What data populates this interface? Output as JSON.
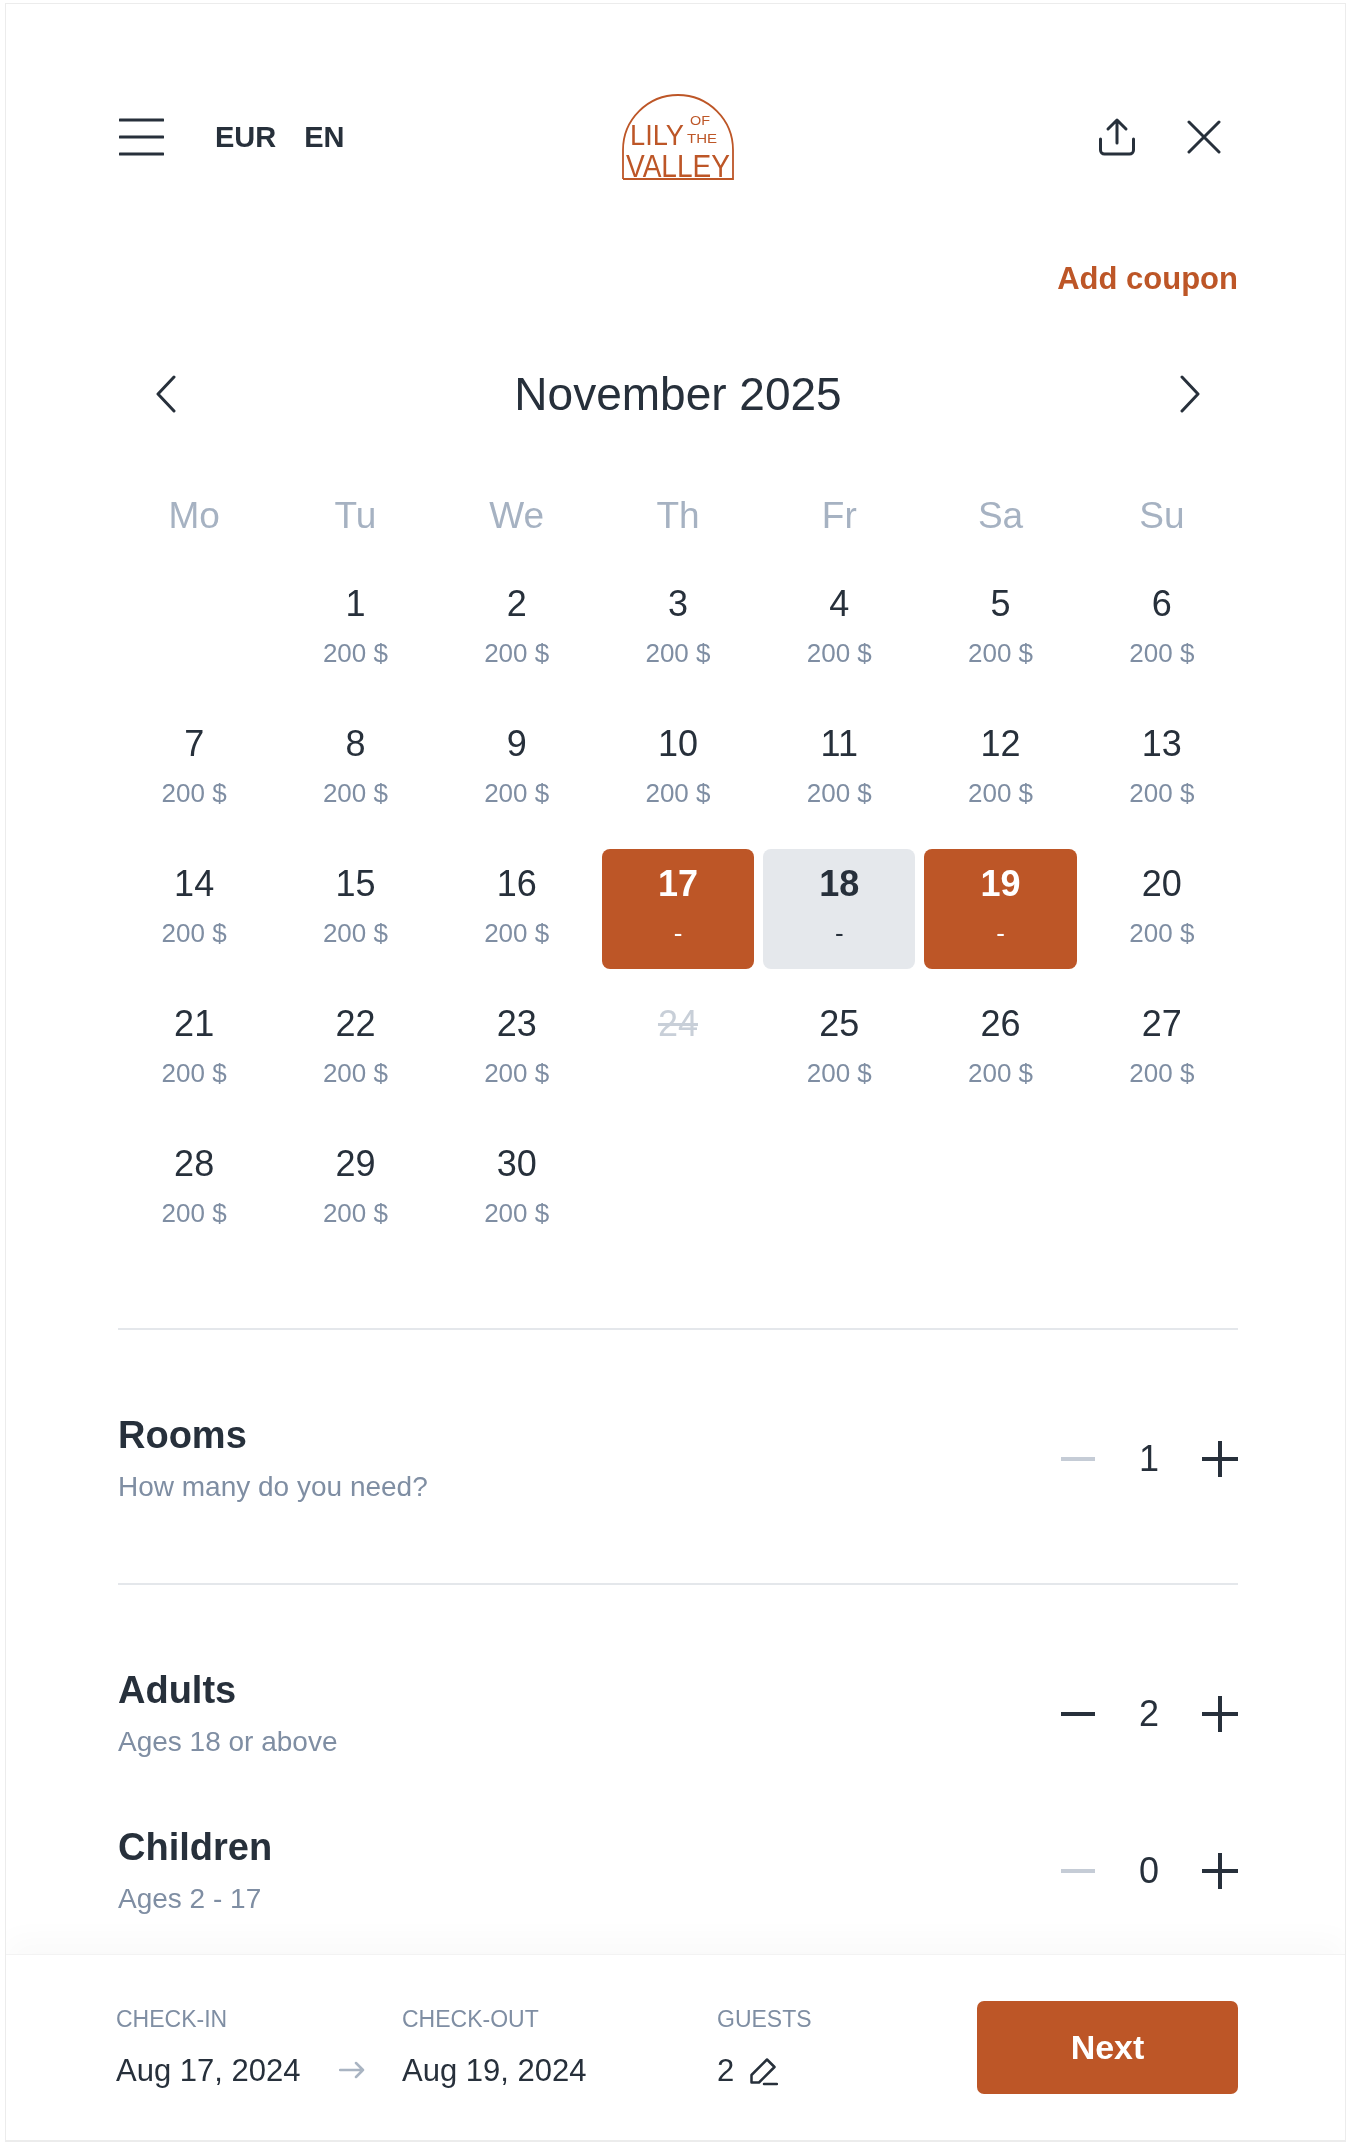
{
  "header": {
    "currency": "EUR",
    "language": "EN",
    "logo": {
      "lines": [
        "LILY",
        "OF",
        "THE",
        "VALLEY"
      ]
    }
  },
  "coupon_link": "Add coupon",
  "calendar": {
    "month": "November 2025",
    "weekdays": [
      "Mo",
      "Tu",
      "We",
      "Th",
      "Fr",
      "Sa",
      "Su"
    ],
    "weeks": [
      {
        "days": [
          {
            "day": "1",
            "price": "200 $",
            "selected": false,
            "in_range": false,
            "disabled": false
          },
          {
            "day": "2",
            "price": "200 $",
            "selected": false,
            "in_range": false,
            "disabled": false
          },
          {
            "day": "3",
            "price": "200 $",
            "selected": false,
            "in_range": false,
            "disabled": false
          },
          {
            "day": "4",
            "price": "200 $",
            "selected": false,
            "in_range": false,
            "disabled": false
          },
          {
            "day": "5",
            "price": "200 $",
            "selected": false,
            "in_range": false,
            "disabled": false
          },
          {
            "day": "6",
            "price": "200 $",
            "selected": false,
            "in_range": false,
            "disabled": false
          }
        ]
      },
      {
        "days": [
          {
            "day": "7",
            "price": "200 $",
            "selected": false,
            "in_range": false,
            "disabled": false
          },
          {
            "day": "8",
            "price": "200 $",
            "selected": false,
            "in_range": false,
            "disabled": false
          },
          {
            "day": "9",
            "price": "200 $",
            "selected": false,
            "in_range": false,
            "disabled": false
          },
          {
            "day": "10",
            "price": "200 $",
            "selected": false,
            "in_range": false,
            "disabled": false
          },
          {
            "day": "11",
            "price": "200 $",
            "selected": false,
            "in_range": false,
            "disabled": false
          },
          {
            "day": "12",
            "price": "200 $",
            "selected": false,
            "in_range": false,
            "disabled": false
          },
          {
            "day": "13",
            "price": "200 $",
            "selected": false,
            "in_range": false,
            "disabled": false
          }
        ]
      },
      {
        "days": [
          {
            "day": "14",
            "price": "200 $",
            "selected": false,
            "in_range": false,
            "disabled": false
          },
          {
            "day": "15",
            "price": "200 $",
            "selected": false,
            "in_range": false,
            "disabled": false
          },
          {
            "day": "16",
            "price": "200 $",
            "selected": false,
            "in_range": false,
            "disabled": false
          },
          {
            "day": "17",
            "price": "-",
            "selected": true,
            "in_range": false,
            "disabled": false
          },
          {
            "day": "18",
            "price": "-",
            "selected": false,
            "in_range": true,
            "disabled": false
          },
          {
            "day": "19",
            "price": "-",
            "selected": true,
            "in_range": false,
            "disabled": false
          },
          {
            "day": "20",
            "price": "200 $",
            "selected": false,
            "in_range": false,
            "disabled": false
          }
        ]
      },
      {
        "days": [
          {
            "day": "21",
            "price": "200 $",
            "selected": false,
            "in_range": false,
            "disabled": false
          },
          {
            "day": "22",
            "price": "200 $",
            "selected": false,
            "in_range": false,
            "disabled": false
          },
          {
            "day": "23",
            "price": "200 $",
            "selected": false,
            "in_range": false,
            "disabled": false
          },
          {
            "day": "24",
            "selected": false,
            "in_range": false,
            "disabled": true
          },
          {
            "day": "25",
            "price": "200 $",
            "selected": false,
            "in_range": false,
            "disabled": false
          },
          {
            "day": "26",
            "price": "200 $",
            "selected": false,
            "in_range": false,
            "disabled": false
          },
          {
            "day": "27",
            "price": "200 $",
            "selected": false,
            "in_range": false,
            "disabled": false
          }
        ]
      },
      {
        "days": [
          {
            "day": "28",
            "price": "200 $",
            "selected": false,
            "in_range": false,
            "disabled": false
          },
          {
            "day": "29",
            "price": "200 $",
            "selected": false,
            "in_range": false,
            "disabled": false
          },
          {
            "day": "30",
            "price": "200 $",
            "selected": false,
            "in_range": false,
            "disabled": false
          }
        ]
      }
    ]
  },
  "sections": [
    {
      "counters": [
        {
          "title": "Rooms",
          "subtitle": "How many do you need?",
          "value": "1",
          "decrement_disabled": true,
          "increment_disabled": false
        }
      ]
    },
    {
      "counters": [
        {
          "title": "Adults",
          "subtitle": "Ages 18 or above",
          "value": "2",
          "decrement_disabled": false,
          "increment_disabled": false
        },
        {
          "title": "Children",
          "subtitle": "Ages 2 - 17",
          "value": "0",
          "decrement_disabled": true,
          "increment_disabled": false
        }
      ]
    }
  ],
  "summary": {
    "check_in": {
      "label": "CHECK-IN",
      "value": "Aug 17, 2024"
    },
    "check_out": {
      "label": "CHECK-OUT",
      "value": "Aug 19, 2024"
    },
    "guests": {
      "label": "GUESTS",
      "value": "2"
    },
    "next_button": "Next"
  }
}
